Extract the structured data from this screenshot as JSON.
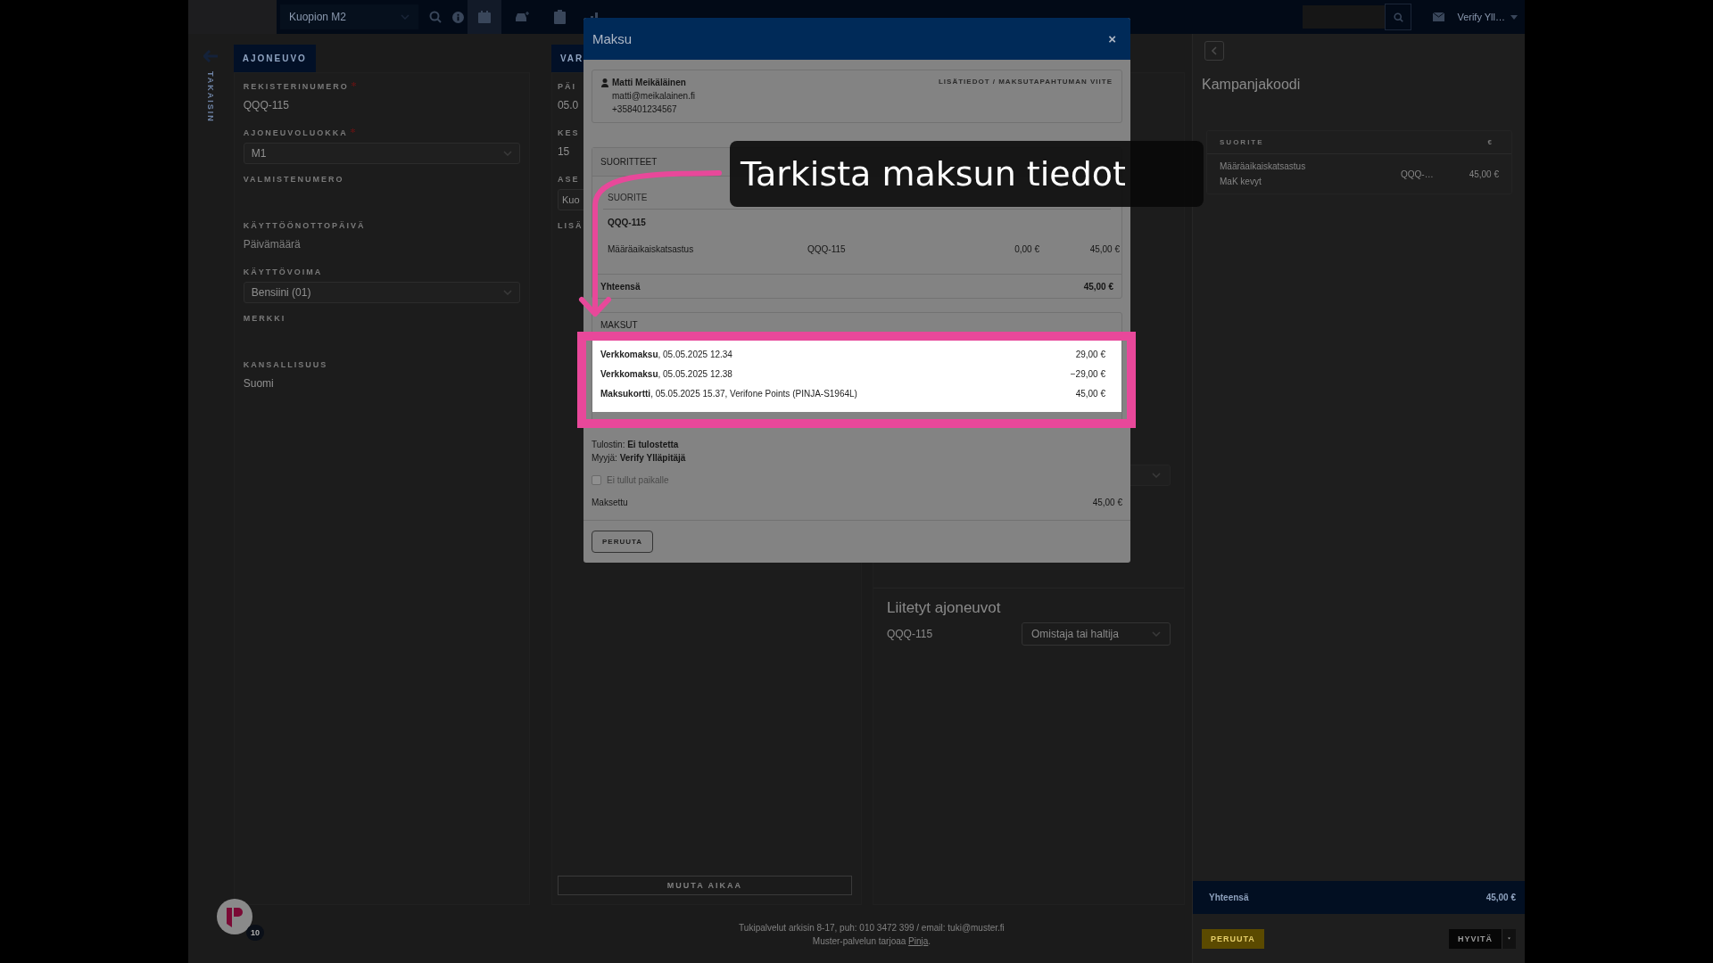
{
  "top_bar": {
    "location_select": "Kuopion M2",
    "nav_items": [
      {
        "kind": "calendar",
        "selected": true
      },
      {
        "kind": "car",
        "selected": false
      },
      {
        "kind": "clipboard",
        "selected": false
      },
      {
        "kind": "chart",
        "selected": false
      }
    ],
    "user_menu": "Verify Yll…"
  },
  "side_nav": {
    "back_label": "TAKAISIN"
  },
  "vehicle_card": {
    "tab": "AJONEUVO",
    "fields": [
      {
        "label": "REKISTERINUMERO",
        "required": true,
        "kind": "text",
        "value": "QQQ-115"
      },
      {
        "label": "AJONEUVOLUOKKA",
        "required": true,
        "kind": "select",
        "value": "M1"
      },
      {
        "label": "VALMISTENUMERO",
        "required": false,
        "kind": "text"
      },
      {
        "label": "KÄYTTÖÖNOTTOPÄIVÄ",
        "required": false,
        "kind": "text",
        "placeholder": "Päivämäärä"
      },
      {
        "label": "KÄYTTÖVOIMA",
        "required": false,
        "kind": "select",
        "value": "Bensiini (01)"
      },
      {
        "label": "MERKKI",
        "required": false,
        "kind": "text"
      },
      {
        "label": "KANSALLISUUS",
        "required": false,
        "kind": "text",
        "value": "Suomi"
      }
    ]
  },
  "booking_card": {
    "tab": "VAR",
    "fields": [
      {
        "label": "PÄI",
        "kind": "text",
        "value": "05.0"
      },
      {
        "label": "KES",
        "kind": "text",
        "value": "15"
      },
      {
        "label": "ASE",
        "kind": "select",
        "value": "Kuo"
      },
      {
        "label": "LISÄ",
        "kind": "text"
      }
    ],
    "change_time_button": "MUUTA AIKAA"
  },
  "vehicles_card": {
    "title": "Liitetyt ajoneuvot",
    "vehicles": [
      {
        "plate": "QQQ-115",
        "role": "Omistaja tai haltija"
      }
    ]
  },
  "footer": {
    "support": "Tukipalvelut arkisin 8-17, puh: 010 3472 399 / email: tuki@muster.fi",
    "provider_before": "Muster-palvelun tarjoaa ",
    "provider_link": "Pinja",
    "provider_after": "."
  },
  "summary_panel": {
    "title": "Kampanjakoodi",
    "columns": [
      "SUORITE",
      "€"
    ],
    "rows": [
      {
        "name": "Määräaikaiskatsastus",
        "detail": "MaK kevyt",
        "vehicle": "QQQ-…",
        "price": "45,00 €"
      }
    ],
    "total_label": "Yhteensä",
    "total": "45,00 €",
    "cancel_button": "PERUUTA",
    "refund_button": "HYVITÄ"
  },
  "chat_widget": {
    "badge": "10"
  },
  "modal": {
    "title": "Maksu",
    "close": "×",
    "customer": {
      "name": "Matti Meikäläinen",
      "email": "matti@meikalainen.fi",
      "phone": "+358401234567",
      "reference_label": "LISÄTIEDOT / MAKSUTAPAHTUMAN VIITE"
    },
    "services": {
      "title": "SUORITTEET",
      "columns": [
        "SUORITE"
      ],
      "group": "QQQ-115",
      "rows": [
        {
          "name": "Määräaikaiskatsastus",
          "info": "QQQ-115",
          "discount": "0,00 €",
          "price": "45,00 €"
        }
      ],
      "total_label": "Yhteensä",
      "total": "45,00 €"
    },
    "payments": {
      "title": "MAKSUT",
      "items": [
        {
          "text": "**Verkkomaksu**, 05.05.2025 12.34",
          "amount": "29,00 €"
        },
        {
          "text": "**Verkkomaksu**, 05.05.2025 12.38",
          "amount": "−29,00 €"
        },
        {
          "text": "**Maksukortti**, 05.05.2025 15.37, Verifone Points (PINJA-S1964L)",
          "amount": "45,00 €"
        }
      ]
    },
    "printer": "Tulostin: **Ei tulostetta**",
    "seller": "Myyjä: **Verify Ylläpitäjä**",
    "no_show": {
      "label": "Ei tullut paikalle",
      "checked": false,
      "disabled": true
    },
    "paid_label": "Maksettu",
    "paid": "45,00 €",
    "cancel_button": "PERUUTA"
  },
  "callout": {
    "text": "Tarkista maksun tiedot"
  }
}
